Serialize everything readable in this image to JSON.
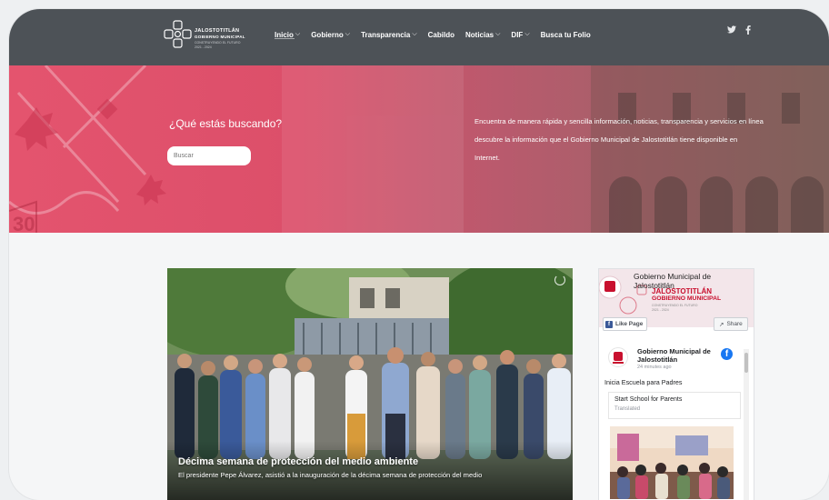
{
  "header": {
    "logo": {
      "line1": "JALOSTOTITLÁN",
      "line2": "GOBIERNO MUNICIPAL",
      "line3": "CONSTRUYENDO EL FUTURO",
      "line4": "2021 - 2024"
    },
    "nav": [
      {
        "label": "Inicio",
        "dropdown": true
      },
      {
        "label": "Gobierno",
        "dropdown": true
      },
      {
        "label": "Transparencia",
        "dropdown": true
      },
      {
        "label": "Cabildo",
        "dropdown": false
      },
      {
        "label": "Noticias",
        "dropdown": true
      },
      {
        "label": "DIF",
        "dropdown": true
      },
      {
        "label": "Busca tu Folio",
        "dropdown": false
      }
    ],
    "caret": "⌵",
    "social": [
      "twitter-icon",
      "facebook-icon"
    ]
  },
  "hero": {
    "title": "¿Qué estás buscando?",
    "search_placeholder": "Buscar",
    "description": "Encuentra de manera rápida y sencilla información, noticias, transparencia y servicios en línea descubre la información que el Gobierno Municipal de Jalostotitlán tiene disponible en Internet."
  },
  "feature": {
    "title": "Décima semana de protección del medio ambiente",
    "description": "El presidente Pepe Álvarez, asistió a la inauguración de la décima semana de protección del medio"
  },
  "facebook": {
    "page_name": "Gobierno Municipal de Jalostotitlán",
    "cover_text1": "JALOSTOTITLÁN",
    "cover_text2": "GOBIERNO MUNICIPAL",
    "cover_text3": "CONSTRUYENDO EL FUTURO",
    "cover_text4": "2021 - 2024",
    "like_label": "Like Page",
    "like_icon": "f",
    "share_label": "Share",
    "share_icon": "↗",
    "post": {
      "author": "Gobierno Municipal de Jalostotitlán",
      "time": "24 minutes ago",
      "brand_glyph": "f",
      "text": "Inicia Escuela para Padres",
      "translated_text": "Start School for Parents",
      "translated_label": "Translated"
    }
  },
  "colors": {
    "header_bg": "#4d5257",
    "hero_accent": "#e4546e",
    "brand_red": "#c8102e",
    "facebook_blue": "#1877f2"
  }
}
